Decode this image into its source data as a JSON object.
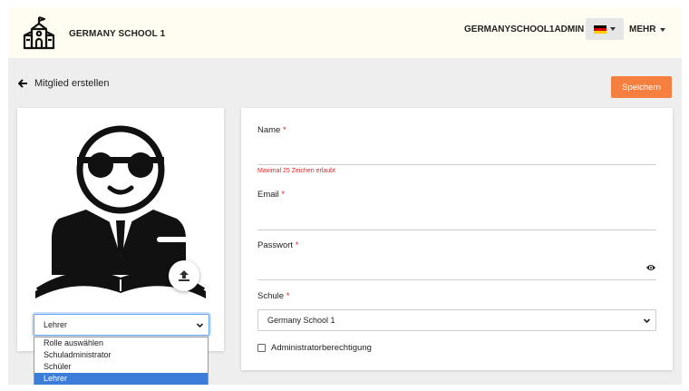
{
  "header": {
    "school_name": "GERMANY SCHOOL 1",
    "admin_name": "GERMANYSCHOOL1ADMIN",
    "more_label": "MEHR",
    "flag_colors": [
      "#000000",
      "#dd0000",
      "#ffce00"
    ]
  },
  "page": {
    "back_label": "Mitglied erstellen",
    "save_label": "Speichern"
  },
  "role": {
    "selected": "Lehrer",
    "options": [
      "Rolle auswählen",
      "Schuladministrator",
      "Schüler",
      "Lehrer"
    ]
  },
  "form": {
    "name_label": "Name",
    "name_hint": "Maximal 25 Zeichen erlaubt",
    "email_label": "Email",
    "password_label": "Passwort",
    "school_label": "Schule",
    "school_value": "Germany School 1",
    "admin_checkbox_label": "Administratorberechtigung",
    "required_mark": "*"
  },
  "colors": {
    "accent": "#f57f3f",
    "required": "#e02525",
    "selected_option": "#3b7dd8"
  },
  "icons": [
    "school-building-icon",
    "arrow-left-icon",
    "upload-icon",
    "eye-icon",
    "chevron-down-icon",
    "caret-down-icon"
  ]
}
